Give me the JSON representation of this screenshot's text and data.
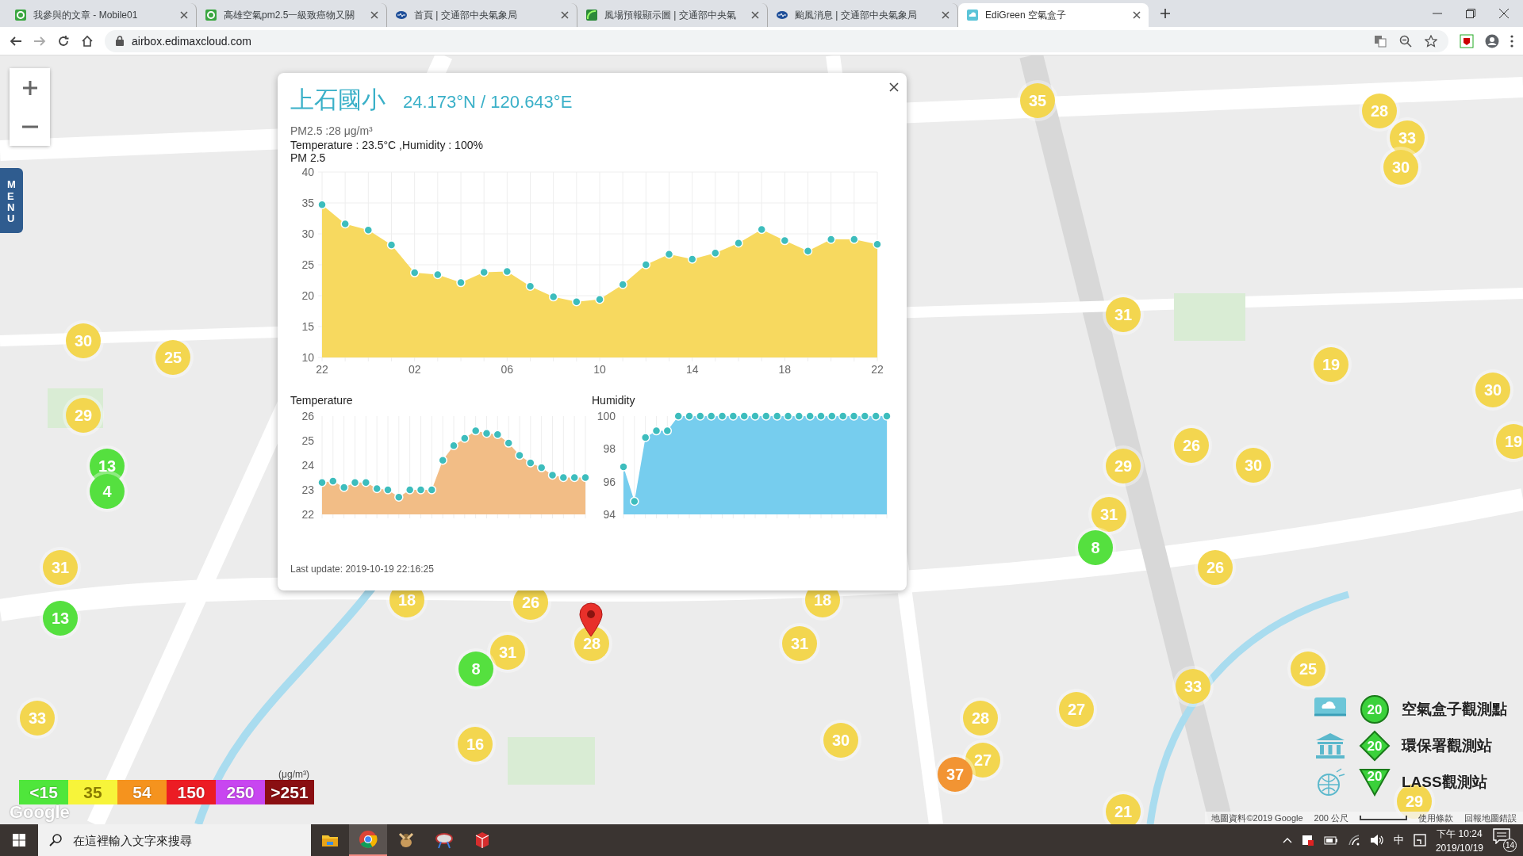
{
  "browser": {
    "tabs": [
      {
        "kind": "mobile01",
        "title": "我參與的文章 - Mobile01",
        "selected": false
      },
      {
        "kind": "mobile01",
        "title": "高雄空氣pm2.5一級致癌物又關",
        "selected": false
      },
      {
        "kind": "cwb",
        "title": "首頁 | 交通部中央氣象局",
        "selected": false
      },
      {
        "kind": "wind",
        "title": "風場預報顯示圖 | 交通部中央氣",
        "selected": false
      },
      {
        "kind": "cwb",
        "title": "颱風消息 | 交通部中央氣象局",
        "selected": false
      },
      {
        "kind": "edigreen",
        "title": "EdiGreen 空氣盒子",
        "selected": true
      }
    ],
    "address": "airbox.edimaxcloud.com"
  },
  "map": {
    "menu": "MENU",
    "markers": [
      {
        "value": "35",
        "color": "#f3d64f"
      },
      {
        "value": "28",
        "color": "#f3d64f"
      },
      {
        "value": "33",
        "color": "#f3d64f"
      },
      {
        "value": "30",
        "color": "#f3d64f"
      },
      {
        "value": "30",
        "color": "#f3d64f"
      },
      {
        "value": "25",
        "color": "#f3d64f"
      },
      {
        "value": "31",
        "color": "#f3d64f"
      },
      {
        "value": "19",
        "color": "#f3d64f"
      },
      {
        "value": "30",
        "color": "#f3d64f"
      },
      {
        "value": "29",
        "color": "#f3d64f"
      },
      {
        "value": "29",
        "color": "#f3d64f"
      },
      {
        "value": "26",
        "color": "#f3d64f"
      },
      {
        "value": "30",
        "color": "#f3d64f"
      },
      {
        "value": "19",
        "color": "#f3d64f"
      },
      {
        "value": "31",
        "color": "#f3d64f"
      },
      {
        "value": "31",
        "color": "#f3d64f"
      },
      {
        "value": "26",
        "color": "#f3d64f"
      },
      {
        "value": "18",
        "color": "#f3d64f"
      },
      {
        "value": "26",
        "color": "#f3d64f"
      },
      {
        "value": "18",
        "color": "#f3d64f"
      },
      {
        "value": "31",
        "color": "#f3d64f"
      },
      {
        "value": "31",
        "color": "#f3d64f"
      },
      {
        "value": "28",
        "color": "#f3d64f"
      },
      {
        "value": "25",
        "color": "#f3d64f"
      },
      {
        "value": "33",
        "color": "#f3d64f"
      },
      {
        "value": "33",
        "color": "#f3d64f"
      },
      {
        "value": "27",
        "color": "#f3d64f"
      },
      {
        "value": "28",
        "color": "#f3d64f"
      },
      {
        "value": "30",
        "color": "#f3d64f"
      },
      {
        "value": "16",
        "color": "#f3d64f"
      },
      {
        "value": "27",
        "color": "#f3d64f"
      },
      {
        "value": "29",
        "color": "#f3d64f"
      },
      {
        "value": "21",
        "color": "#f3d64f"
      },
      {
        "value": "13",
        "color": "#55e03f"
      },
      {
        "value": "4",
        "color": "#55e03f"
      },
      {
        "value": "13",
        "color": "#55e03f"
      },
      {
        "value": "8",
        "color": "#55e03f"
      },
      {
        "value": "8",
        "color": "#55e03f"
      },
      {
        "value": "37",
        "color": "#f29433"
      }
    ],
    "popup": {
      "name": "上石國小",
      "coords": "24.173°N / 120.643°E",
      "pm": "PM2.5 :28 μg/m³",
      "readings": "Temperature : 23.5°C ,Humidity : 100%",
      "charts": [
        {
          "chart_data": {
            "type": "area",
            "title": "PM 2.5",
            "grid": true,
            "ylim": [
              10,
              40
            ],
            "yticks": [
              10,
              15,
              20,
              25,
              30,
              35,
              40
            ],
            "categories": [
              "22",
              null,
              null,
              null,
              "02",
              null,
              null,
              null,
              "06",
              null,
              null,
              null,
              "10",
              null,
              null,
              null,
              "14",
              null,
              null,
              null,
              "18",
              null,
              null,
              null,
              "22"
            ],
            "series": [
              {
                "color": "#f7d95f",
                "values": [
                  34.7,
                  31.6,
                  30.6,
                  28.2,
                  23.7,
                  23.4,
                  22.1,
                  23.8,
                  23.9,
                  21.5,
                  19.8,
                  19.0,
                  19.4,
                  21.8,
                  25.0,
                  26.7,
                  25.9,
                  26.9,
                  28.5,
                  30.7,
                  28.9,
                  27.2,
                  29.1,
                  29.1,
                  28.3
                ]
              }
            ]
          }
        },
        {
          "kind": "picture",
          "title": "Temperature",
          "color": "#f2bd86",
          "y_labels": [
            "26",
            "25",
            "24",
            "23",
            "22"
          ]
        },
        {
          "kind": "picture",
          "title": "Humidity",
          "color": "#76cdee",
          "y_labels": [
            "100",
            "98",
            "96",
            "94"
          ]
        }
      ],
      "last_update": "Last update: 2019-10-19 22:16:25"
    },
    "scale_legend": {
      "unit": "(μg/m³)",
      "items": [
        {
          "label": "<15",
          "color": "#4fe63b"
        },
        {
          "label": "35",
          "color": "#f7f43a"
        },
        {
          "label": "54",
          "color": "#f5931e"
        },
        {
          "label": "150",
          "color": "#ec1c24"
        },
        {
          "label": "250",
          "color": "#c846f0"
        },
        {
          "label": ">251",
          "color": "#8a0f12"
        }
      ]
    },
    "google": "Google",
    "station_legend": [
      {
        "kind": "circle",
        "count": "20",
        "label": "空氣盒子觀測點"
      },
      {
        "kind": "diamond",
        "count": "20",
        "label": "環保署觀測站"
      },
      {
        "kind": "triangle",
        "count": "20",
        "label": "LASS觀測站"
      }
    ],
    "attribution": {
      "data": "地圖資料©2019 Google",
      "scale": "200 公尺",
      "terms": "使用條款",
      "report": "回報地圖錯誤"
    }
  },
  "taskbar": {
    "search": {
      "placeholder": "在這裡輸入文字來搜尋"
    },
    "apps": [
      {
        "kind": "explorer",
        "selected": false
      },
      {
        "kind": "chrome",
        "selected": true
      },
      {
        "kind": "bird",
        "selected": false
      },
      {
        "kind": "tool",
        "selected": false
      },
      {
        "kind": "sketch",
        "selected": false
      }
    ],
    "ime": "中",
    "time": "下午 10:24",
    "date": "2019/10/19",
    "notifications": "14"
  }
}
